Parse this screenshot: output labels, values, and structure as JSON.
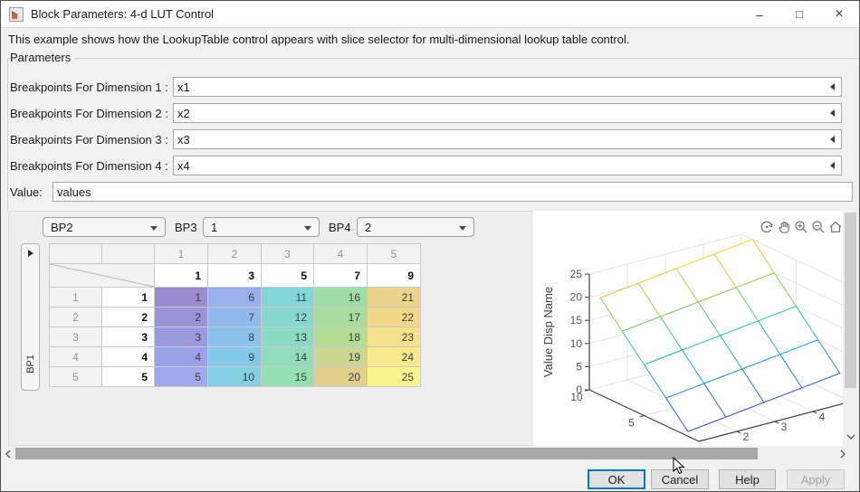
{
  "window": {
    "title": "Block Parameters: 4-d LUT Control",
    "controls": {
      "minimize": "–",
      "maximize": "□",
      "close": "×"
    }
  },
  "description": "This example shows how the LookupTable control appears with slice selector for multi-dimensional lookup table control.",
  "parameters": {
    "group_label": "Parameters",
    "fields": [
      {
        "label": "Breakpoints For Dimension 1 :",
        "value": "x1"
      },
      {
        "label": "Breakpoints For Dimension 2 :",
        "value": "x2"
      },
      {
        "label": "Breakpoints For Dimension 3 :",
        "value": "x3"
      },
      {
        "label": "Breakpoints For Dimension 4 :",
        "value": "x4"
      }
    ],
    "value_field": {
      "label": "Value:",
      "value": "values"
    }
  },
  "slice_selector": {
    "dim_combo": {
      "value": "BP2"
    },
    "bp3_label": "BP3",
    "bp3_combo": {
      "value": "1"
    },
    "bp4_label": "BP4",
    "bp4_combo": {
      "value": "2"
    }
  },
  "table": {
    "side_tab": {
      "label": "BP1"
    },
    "column_indices": [
      "1",
      "2",
      "3",
      "4",
      "5"
    ],
    "column_breakpoints": [
      "1",
      "3",
      "5",
      "7",
      "9"
    ],
    "row_indices": [
      "1",
      "2",
      "3",
      "4",
      "5"
    ],
    "row_breakpoints": [
      "1",
      "2",
      "3",
      "4",
      "5"
    ],
    "values": [
      [
        1,
        6,
        11,
        16,
        21
      ],
      [
        2,
        7,
        12,
        17,
        22
      ],
      [
        3,
        8,
        13,
        18,
        23
      ],
      [
        4,
        9,
        14,
        19,
        24
      ],
      [
        5,
        10,
        15,
        20,
        25
      ]
    ],
    "value_range": [
      1,
      25
    ],
    "cell_colormap": [
      [
        0,
        "#988cce"
      ],
      [
        0.17,
        "#9fa9ee"
      ],
      [
        0.33,
        "#86c8ea"
      ],
      [
        0.42,
        "#82d5d8"
      ],
      [
        0.58,
        "#93dfb0"
      ],
      [
        0.71,
        "#b4dc94"
      ],
      [
        0.79,
        "#e2cf8c"
      ],
      [
        0.875,
        "#f2d68a"
      ],
      [
        1,
        "#faf48e"
      ]
    ]
  },
  "chart_data": {
    "type": "surface-mesh",
    "title": "",
    "zlabel": "Value Disp Name",
    "x": [
      1,
      2,
      3,
      4,
      5
    ],
    "y": [
      1,
      3,
      5,
      7,
      9
    ],
    "z_values": [
      [
        1,
        6,
        11,
        16,
        21
      ],
      [
        2,
        7,
        12,
        17,
        22
      ],
      [
        3,
        8,
        13,
        18,
        23
      ],
      [
        4,
        9,
        14,
        19,
        24
      ],
      [
        5,
        10,
        15,
        20,
        25
      ]
    ],
    "x_range": [
      1,
      5
    ],
    "y_range": [
      0,
      10
    ],
    "z_range": [
      0,
      25
    ],
    "x_ticks": [
      2,
      3,
      4
    ],
    "y_ticks": [
      5,
      10
    ],
    "z_ticks": [
      0,
      5,
      10,
      15,
      20,
      25
    ],
    "grid": true,
    "colormap_stops": [
      [
        0,
        "#4c50d2"
      ],
      [
        0.18,
        "#3f7ee6"
      ],
      [
        0.38,
        "#2db6d4"
      ],
      [
        0.55,
        "#46cd9c"
      ],
      [
        0.72,
        "#95d160"
      ],
      [
        0.86,
        "#e3c843"
      ],
      [
        1,
        "#f7e33c"
      ]
    ]
  },
  "plot_toolbar": {
    "icons": [
      "rotate-3d",
      "pan",
      "zoom-in",
      "zoom-out",
      "home"
    ]
  },
  "buttons": [
    {
      "label": "OK",
      "state": "focused"
    },
    {
      "label": "Cancel",
      "state": "normal"
    },
    {
      "label": "Help",
      "state": "normal"
    },
    {
      "label": "Apply",
      "state": "disabled"
    }
  ],
  "colors": {
    "focus_blue": "#0078d7",
    "pane_bg": "#eeeeee",
    "content_bg": "#f1f1f1",
    "axis": "#3f3f3f",
    "gridline": "#e4e4e4"
  }
}
